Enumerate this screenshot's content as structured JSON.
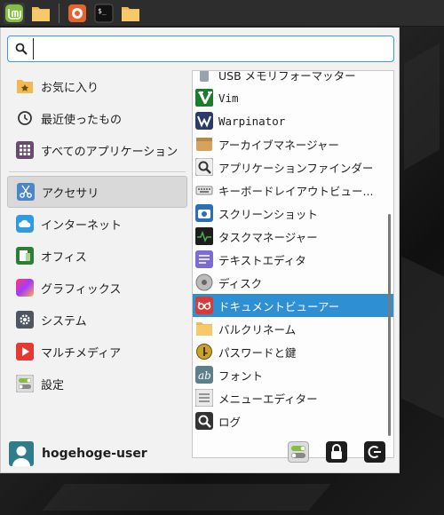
{
  "panel": {
    "buttons": [
      {
        "icon": "mint-menu-icon"
      },
      {
        "icon": "folder-icon"
      },
      {
        "icon": "firefox-icon"
      },
      {
        "icon": "terminal-icon",
        "label": "$_"
      },
      {
        "icon": "folder-icon"
      }
    ]
  },
  "search": {
    "placeholder": "",
    "value": ""
  },
  "categories": [
    {
      "label": "お気に入り",
      "icon": "star-folder-icon"
    },
    {
      "label": "最近使ったもの",
      "icon": "clock-icon"
    },
    {
      "label": "すべてのアプリケーション",
      "icon": "grid-icon"
    },
    {
      "label": "アクセサリ",
      "icon": "scissors-icon",
      "active": true
    },
    {
      "label": "インターネット",
      "icon": "cloud-icon"
    },
    {
      "label": "オフィス",
      "icon": "office-icon"
    },
    {
      "label": "グラフィックス",
      "icon": "graphics-icon"
    },
    {
      "label": "システム",
      "icon": "gear-icon"
    },
    {
      "label": "マルチメディア",
      "icon": "play-icon"
    },
    {
      "label": "設定",
      "icon": "toggle-icon"
    }
  ],
  "apps": [
    {
      "label": "USB メモリフォーマッター",
      "icon": "usb-icon"
    },
    {
      "label": "Vim",
      "icon": "vim-icon",
      "mono": true
    },
    {
      "label": "Warpinator",
      "icon": "warpinator-icon",
      "mono": true
    },
    {
      "label": "アーカイブマネージャー",
      "icon": "archive-icon"
    },
    {
      "label": "アプリケーションファインダー",
      "icon": "magnifier-icon"
    },
    {
      "label": "キーボードレイアウトビュー...",
      "icon": "keyboard-icon"
    },
    {
      "label": "スクリーンショット",
      "icon": "camera-icon"
    },
    {
      "label": "タスクマネージャー",
      "icon": "monitor-icon"
    },
    {
      "label": "テキストエディタ",
      "icon": "text-editor-icon"
    },
    {
      "label": "ディスク",
      "icon": "disk-icon"
    },
    {
      "label": "ドキュメントビューアー",
      "icon": "document-viewer-icon",
      "selected": true
    },
    {
      "label": "バルクリネーム",
      "icon": "folder-icon"
    },
    {
      "label": "パスワードと鍵",
      "icon": "key-icon"
    },
    {
      "label": "フォント",
      "icon": "font-icon"
    },
    {
      "label": "メニューエディター",
      "icon": "menu-editor-icon"
    },
    {
      "label": "ログ",
      "icon": "log-icon"
    }
  ],
  "footer": {
    "username": "hogehoge-user",
    "buttons": [
      "settings-toggle-icon",
      "lock-icon",
      "logout-icon"
    ]
  },
  "colors": {
    "accent": "#2f8fd3",
    "search_border": "#35a0d6",
    "mint_green": "#86be43"
  }
}
